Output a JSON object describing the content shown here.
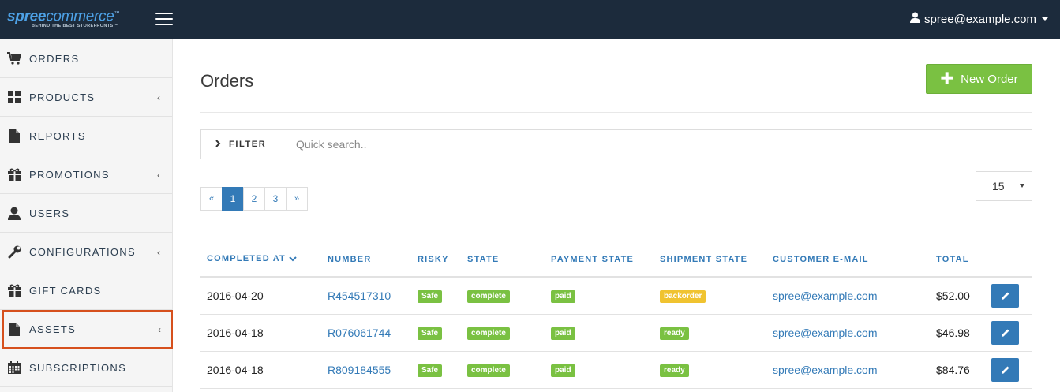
{
  "brand": {
    "name_a": "spree",
    "name_b": "commerce",
    "tm": "™",
    "tagline": "BEHIND THE BEST STOREFRONTS™"
  },
  "user": {
    "email": "spree@example.com"
  },
  "sidebar": {
    "items": [
      {
        "label": "ORDERS",
        "icon": "cart-icon",
        "chevron": false
      },
      {
        "label": "PRODUCTS",
        "icon": "grid-icon",
        "chevron": true
      },
      {
        "label": "REPORTS",
        "icon": "file-icon",
        "chevron": false
      },
      {
        "label": "PROMOTIONS",
        "icon": "gift-icon",
        "chevron": true
      },
      {
        "label": "USERS",
        "icon": "user-icon",
        "chevron": false
      },
      {
        "label": "CONFIGURATIONS",
        "icon": "wrench-icon",
        "chevron": true
      },
      {
        "label": "GIFT CARDS",
        "icon": "gift-icon",
        "chevron": false
      },
      {
        "label": "ASSETS",
        "icon": "file-icon",
        "chevron": true
      },
      {
        "label": "SUBSCRIPTIONS",
        "icon": "calendar-icon",
        "chevron": false
      }
    ],
    "chevron_glyph": "‹"
  },
  "page": {
    "title": "Orders",
    "new_order_label": "New Order"
  },
  "filter": {
    "label": "FILTER",
    "search_placeholder": "Quick search.."
  },
  "pagination": {
    "prev": "«",
    "pages": [
      "1",
      "2",
      "3"
    ],
    "next": "»",
    "active": "1"
  },
  "per_page": {
    "value": "15"
  },
  "table": {
    "columns": [
      "COMPLETED AT",
      "NUMBER",
      "RISKY",
      "STATE",
      "PAYMENT STATE",
      "SHIPMENT STATE",
      "CUSTOMER E-MAIL",
      "TOTAL"
    ],
    "rows": [
      {
        "completed_at": "2016-04-20",
        "number": "R454517310",
        "risky": "Safe",
        "state": "complete",
        "payment_state": "paid",
        "shipment_state": "backorder",
        "email": "spree@example.com",
        "total": "$52.00"
      },
      {
        "completed_at": "2016-04-18",
        "number": "R076061744",
        "risky": "Safe",
        "state": "complete",
        "payment_state": "paid",
        "shipment_state": "ready",
        "email": "spree@example.com",
        "total": "$46.98"
      },
      {
        "completed_at": "2016-04-18",
        "number": "R809184555",
        "risky": "Safe",
        "state": "complete",
        "payment_state": "paid",
        "shipment_state": "ready",
        "email": "spree@example.com",
        "total": "$84.76"
      }
    ]
  },
  "colors": {
    "topbar": "#1c2b3c",
    "accent": "#337ab7",
    "success": "#7ac142",
    "warning": "#f0c330",
    "highlight": "#d6501d"
  }
}
